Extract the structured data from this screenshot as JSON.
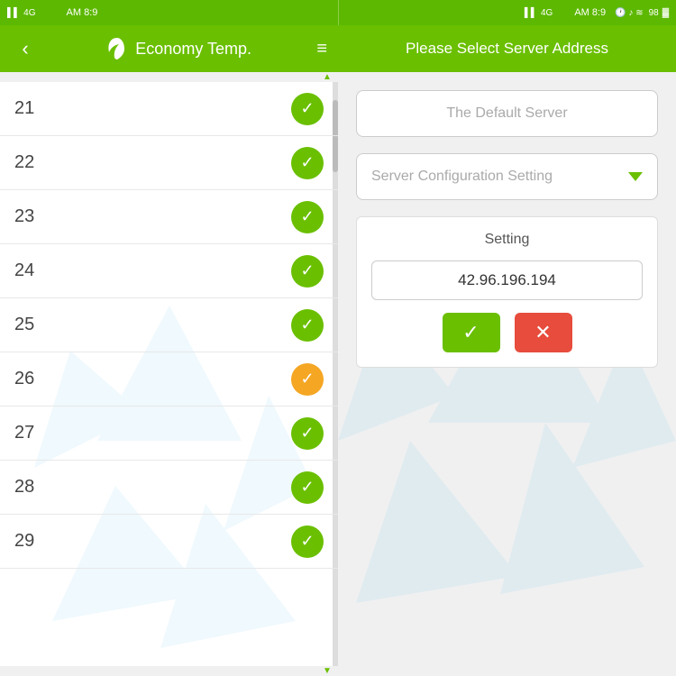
{
  "status_bar": {
    "left": {
      "signal": "4G",
      "time": "AM 8:9"
    },
    "right": {
      "time": "AM 8:9",
      "battery": "98"
    }
  },
  "left_panel": {
    "header": {
      "back_label": "‹",
      "title": "Economy Temp.",
      "menu_icon": "≡"
    },
    "list_items": [
      {
        "number": "21",
        "check_type": "green"
      },
      {
        "number": "22",
        "check_type": "green"
      },
      {
        "number": "23",
        "check_type": "green"
      },
      {
        "number": "24",
        "check_type": "green"
      },
      {
        "number": "25",
        "check_type": "green"
      },
      {
        "number": "26",
        "check_type": "orange"
      },
      {
        "number": "27",
        "check_type": "green"
      },
      {
        "number": "28",
        "check_type": "green"
      },
      {
        "number": "29",
        "check_type": "green"
      }
    ]
  },
  "right_panel": {
    "header": {
      "title": "Please Select Server Address"
    },
    "default_server_label": "The Default Server",
    "server_config_label": "Server Configuration Setting",
    "dropdown_arrow": "▼",
    "setting_box": {
      "title": "Setting",
      "ip_address": "42.96.196.194",
      "confirm_icon": "✓",
      "cancel_icon": "✕"
    }
  },
  "check_mark": "✓"
}
